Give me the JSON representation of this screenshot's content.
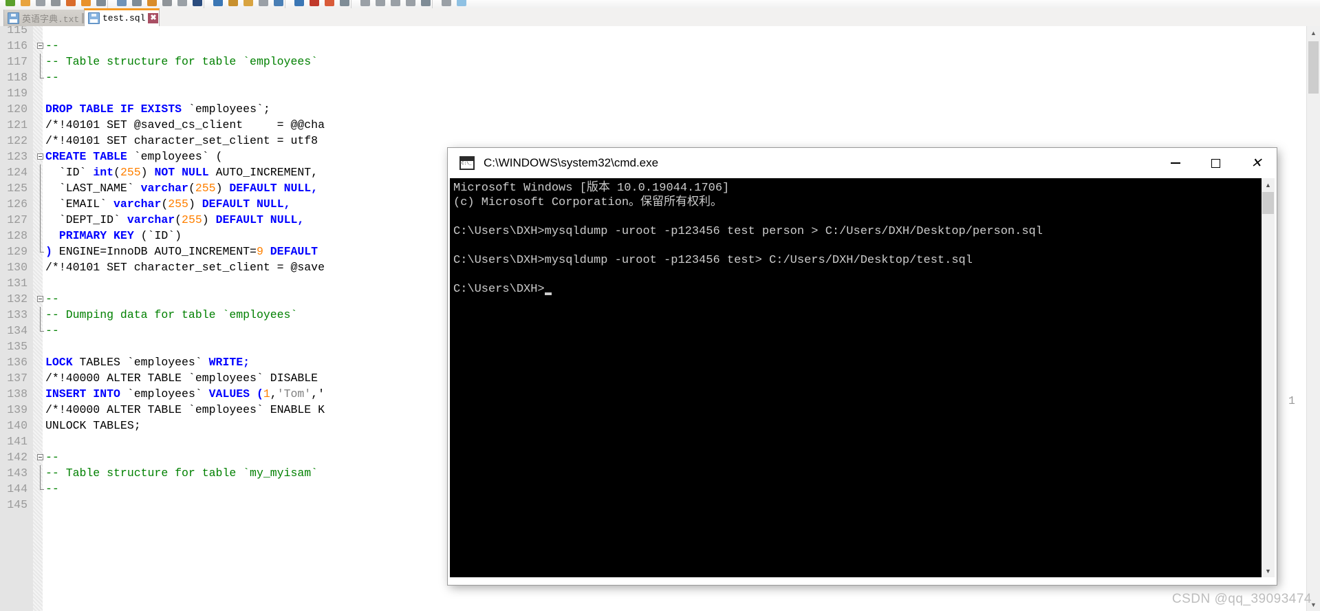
{
  "app": {
    "tabs": [
      {
        "label": "英语字典.txt",
        "active": false,
        "icon": "floppy-disk-icon",
        "close": "✖"
      },
      {
        "label": "test.sql",
        "active": true,
        "icon": "floppy-disk-icon",
        "close": "✖"
      }
    ]
  },
  "editor": {
    "first_line_number": 115,
    "partial_right_text": "1",
    "lines": [
      {
        "n": "115",
        "segs": []
      },
      {
        "n": "116",
        "fold": "start",
        "segs": [
          {
            "t": "--",
            "c": "cm"
          }
        ]
      },
      {
        "n": "117",
        "fold": "mid",
        "segs": [
          {
            "t": "-- Table structure for table `employees`",
            "c": "cm"
          }
        ]
      },
      {
        "n": "118",
        "fold": "end",
        "segs": [
          {
            "t": "--",
            "c": "cm"
          }
        ]
      },
      {
        "n": "119",
        "segs": []
      },
      {
        "n": "120",
        "segs": [
          {
            "t": "DROP TABLE IF EXISTS",
            "c": "kw"
          },
          {
            "t": " `employees`;",
            "c": "plain"
          }
        ]
      },
      {
        "n": "121",
        "segs": [
          {
            "t": "/*!40101 SET @saved_cs_client     = @@cha",
            "c": "plain"
          }
        ]
      },
      {
        "n": "122",
        "segs": [
          {
            "t": "/*!40101 SET character_set_client = utf8",
            "c": "plain"
          }
        ]
      },
      {
        "n": "123",
        "fold": "start",
        "segs": [
          {
            "t": "CREATE TABLE",
            "c": "kw"
          },
          {
            "t": " `employees` (",
            "c": "plain"
          }
        ]
      },
      {
        "n": "124",
        "fold": "mid",
        "segs": [
          {
            "t": "  `ID` ",
            "c": "plain"
          },
          {
            "t": "int",
            "c": "kw"
          },
          {
            "t": "(",
            "c": "plain"
          },
          {
            "t": "255",
            "c": "num"
          },
          {
            "t": ") ",
            "c": "plain"
          },
          {
            "t": "NOT NULL",
            "c": "kw"
          },
          {
            "t": " AUTO_INCREMENT,",
            "c": "plain"
          }
        ]
      },
      {
        "n": "125",
        "fold": "mid",
        "segs": [
          {
            "t": "  `LAST_NAME` ",
            "c": "plain"
          },
          {
            "t": "varchar",
            "c": "kw"
          },
          {
            "t": "(",
            "c": "plain"
          },
          {
            "t": "255",
            "c": "num"
          },
          {
            "t": ") ",
            "c": "plain"
          },
          {
            "t": "DEFAULT NULL,",
            "c": "kw"
          }
        ]
      },
      {
        "n": "126",
        "fold": "mid",
        "segs": [
          {
            "t": "  `EMAIL` ",
            "c": "plain"
          },
          {
            "t": "varchar",
            "c": "kw"
          },
          {
            "t": "(",
            "c": "plain"
          },
          {
            "t": "255",
            "c": "num"
          },
          {
            "t": ") ",
            "c": "plain"
          },
          {
            "t": "DEFAULT NULL,",
            "c": "kw"
          }
        ]
      },
      {
        "n": "127",
        "fold": "mid",
        "segs": [
          {
            "t": "  `DEPT_ID` ",
            "c": "plain"
          },
          {
            "t": "varchar",
            "c": "kw"
          },
          {
            "t": "(",
            "c": "plain"
          },
          {
            "t": "255",
            "c": "num"
          },
          {
            "t": ") ",
            "c": "plain"
          },
          {
            "t": "DEFAULT NULL,",
            "c": "kw"
          }
        ]
      },
      {
        "n": "128",
        "fold": "mid",
        "segs": [
          {
            "t": "  ",
            "c": "plain"
          },
          {
            "t": "PRIMARY KEY",
            "c": "kw"
          },
          {
            "t": " (`ID`)",
            "c": "plain"
          }
        ]
      },
      {
        "n": "129",
        "fold": "end",
        "segs": [
          {
            "t": ")",
            "c": "kw"
          },
          {
            "t": " ENGINE=InnoDB AUTO_INCREMENT=",
            "c": "plain"
          },
          {
            "t": "9",
            "c": "num"
          },
          {
            "t": " DEFAULT",
            "c": "kw"
          }
        ]
      },
      {
        "n": "130",
        "segs": [
          {
            "t": "/*!40101 SET character_set_client = @save",
            "c": "plain"
          }
        ]
      },
      {
        "n": "131",
        "segs": []
      },
      {
        "n": "132",
        "fold": "start",
        "segs": [
          {
            "t": "--",
            "c": "cm"
          }
        ]
      },
      {
        "n": "133",
        "fold": "mid",
        "segs": [
          {
            "t": "-- Dumping data for table `employees`",
            "c": "cm"
          }
        ]
      },
      {
        "n": "134",
        "fold": "end",
        "segs": [
          {
            "t": "--",
            "c": "cm"
          }
        ]
      },
      {
        "n": "135",
        "segs": []
      },
      {
        "n": "136",
        "segs": [
          {
            "t": "LOCK",
            "c": "kw"
          },
          {
            "t": " TABLES `employees` ",
            "c": "plain"
          },
          {
            "t": "WRITE;",
            "c": "kw"
          }
        ]
      },
      {
        "n": "137",
        "segs": [
          {
            "t": "/*!40000 ALTER TABLE `employees` DISABLE",
            "c": "plain"
          }
        ]
      },
      {
        "n": "138",
        "segs": [
          {
            "t": "INSERT INTO",
            "c": "kw"
          },
          {
            "t": " `employees` ",
            "c": "plain"
          },
          {
            "t": "VALUES (",
            "c": "kw"
          },
          {
            "t": "1",
            "c": "num"
          },
          {
            "t": ",",
            "c": "plain"
          },
          {
            "t": "'Tom'",
            "c": "str"
          },
          {
            "t": ",'",
            "c": "plain"
          }
        ]
      },
      {
        "n": "139",
        "segs": [
          {
            "t": "/*!40000 ALTER TABLE `employees` ENABLE K",
            "c": "plain"
          }
        ]
      },
      {
        "n": "140",
        "segs": [
          {
            "t": "UNLOCK TABLES;",
            "c": "plain"
          }
        ]
      },
      {
        "n": "141",
        "segs": []
      },
      {
        "n": "142",
        "fold": "start",
        "segs": [
          {
            "t": "--",
            "c": "cm"
          }
        ]
      },
      {
        "n": "143",
        "fold": "mid",
        "segs": [
          {
            "t": "-- Table structure for table `my_myisam`",
            "c": "cm"
          }
        ]
      },
      {
        "n": "144",
        "fold": "end",
        "segs": [
          {
            "t": "--",
            "c": "cm"
          }
        ]
      },
      {
        "n": "145",
        "segs": []
      }
    ]
  },
  "cmd": {
    "title": "C:\\WINDOWS\\system32\\cmd.exe",
    "title_icon": "cmd-icon",
    "buttons": {
      "minimize": "minimize-icon",
      "maximize": "maximize-icon",
      "close": "close-icon"
    },
    "lines": [
      "Microsoft Windows [版本 10.0.19044.1706]",
      "(c) Microsoft Corporation。保留所有权利。",
      "",
      "C:\\Users\\DXH>mysqldump -uroot -p123456 test person > C:/Users/DXH/Desktop/person.sql",
      "",
      "C:\\Users\\DXH>mysqldump -uroot -p123456 test> C:/Users/DXH/Desktop/test.sql",
      "",
      "C:\\Users\\DXH>"
    ]
  },
  "watermark": "CSDN @qq_39093474",
  "colors": {
    "keyword": "#0000ff",
    "comment": "#008000",
    "number": "#ff8000",
    "string": "#808080",
    "active_tab_accent": "#f59a23",
    "close_active": "#a94f64",
    "terminal_bg": "#000000",
    "terminal_fg": "#cccccc"
  }
}
